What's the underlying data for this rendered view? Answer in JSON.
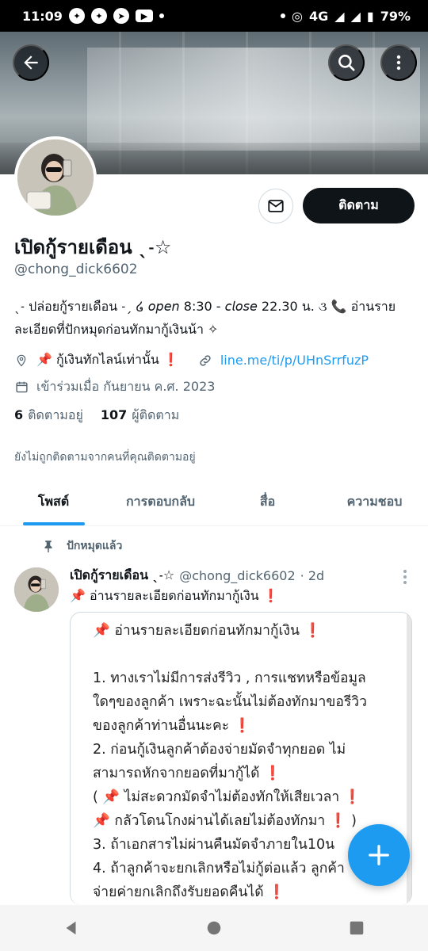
{
  "status_bar": {
    "time": "11:09",
    "network": "4G",
    "battery": "79%"
  },
  "profile": {
    "follow_label": "ติดตาม",
    "name": "เปิดกู้รายเดือน ˎ˗☆",
    "handle": "@chong_dick6602",
    "bio": "ˎ˗ ปล่อยกู้รายเดือน ˗ˏ ໒ 𝘰𝘱𝘦𝘯 8:30 - 𝘤𝘭𝘰𝘴𝘦 22.30 น. ૩ 📞 อ่านรายละเอียดที่ปักหมุดก่อนทักมากู้เงินน้า ✧",
    "location": "📌 กู้เงินทักไลน์เท่านั้น ❗",
    "website": "line.me/ti/p/UHnSrrfuzP",
    "joined": "เข้าร่วมเมื่อ กันยายน ค.ศ. 2023",
    "following_count": "6",
    "following_label": "ติดตามอยู่",
    "followers_count": "107",
    "followers_label": "ผู้ติดตาม",
    "not_followed_text": "ยังไม่ถูกติดตามจากคนที่คุณติดตามอยู่"
  },
  "tabs": [
    {
      "label": "โพสต์",
      "active": true
    },
    {
      "label": "การตอบกลับ",
      "active": false
    },
    {
      "label": "สื่อ",
      "active": false
    },
    {
      "label": "ความชอบ",
      "active": false
    }
  ],
  "post": {
    "pinned_label": "ปักหมุดแล้ว",
    "author_name": "เปิดกู้รายเดือน ˎ˗☆",
    "author_handle": "@chong_dick6602",
    "time": "· 2d",
    "text": "📌 อ่านรายละเอียดก่อนทักมากู้เงิน ❗",
    "image_lines": [
      "📌 อ่านรายละเอียดก่อนทักมากู้เงิน ❗",
      "",
      "1. ทางเราไม่มีการส่งรีวิว , การแชทหรือข้อมูล",
      "ใดๆของลูกค้า เพราะฉะนั้นไม่ต้องทักมาขอรีวิว",
      "ของลูกค้าท่านอื่นนะคะ ❗",
      "2. ก่อนกู้เงินลูกค้าต้องจ่ายมัดจำทุกยอด ไม่",
      "สามารถหักจากยอดที่มากู้ได้ ❗",
      "( 📌 ไม่สะดวกมัดจำไม่ต้องทักให้เสียเวลา ❗",
      "📌 กลัวโดนโกงผ่านได้เลยไม่ต้องทักมา ❗ )",
      "3. ถ้าเอกสารไม่ผ่านคืนมัดจำภายใน10น",
      "4. ถ้าลูกค้าจะยกเลิกหรือไม่กู้ต่อแล้ว ลูกค้า",
      "จ่ายค่ายกเลิกถึงรับยอดคืนได้ ❗"
    ]
  },
  "icons": {
    "back": "arrow-left-icon",
    "search": "search-icon",
    "more": "more-vertical-icon",
    "message": "mail-icon",
    "location": "location-pin-icon",
    "link": "link-icon",
    "calendar": "calendar-icon",
    "pin": "pin-icon",
    "compose": "plus-icon"
  },
  "colors": {
    "accent": "#1d9bf0",
    "text": "#0f1419",
    "muted": "#536471"
  }
}
